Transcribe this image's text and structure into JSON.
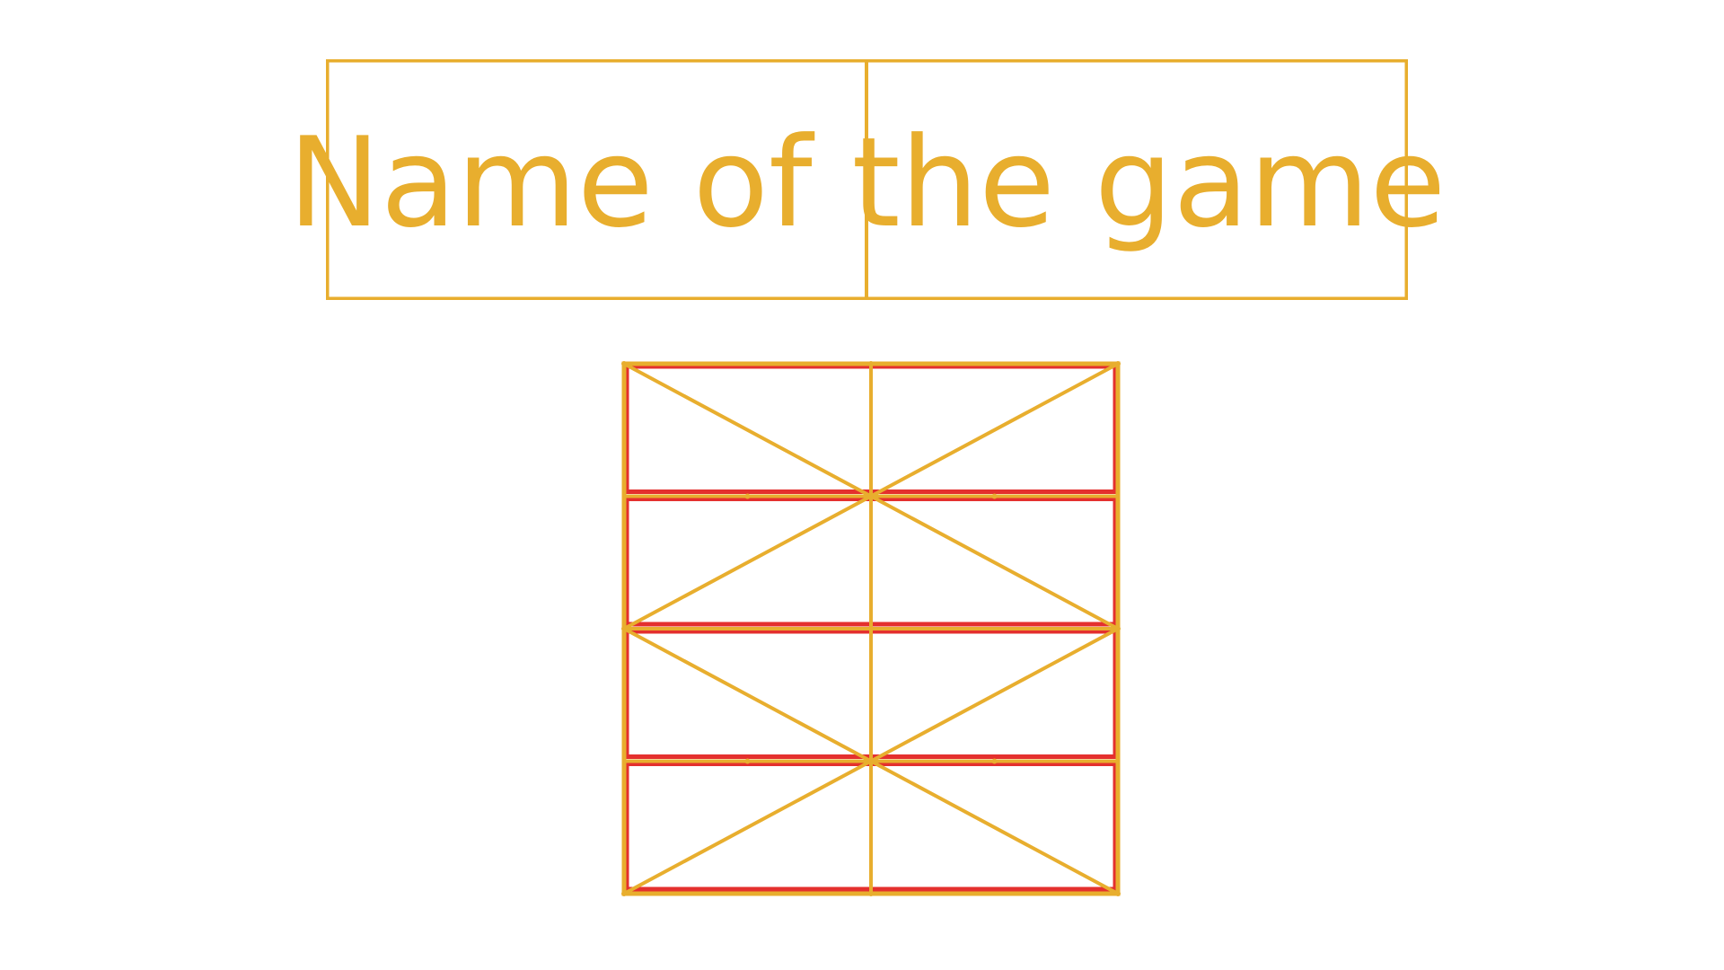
{
  "game": {
    "title": "Name of the game",
    "board": {
      "columns": 2,
      "rows": 4,
      "diagonals": "alternating-x-pattern"
    }
  },
  "colors": {
    "background": "#ffffff",
    "accent_gold": "#E8AE2E",
    "cell_outline_red": "#E4302E"
  }
}
